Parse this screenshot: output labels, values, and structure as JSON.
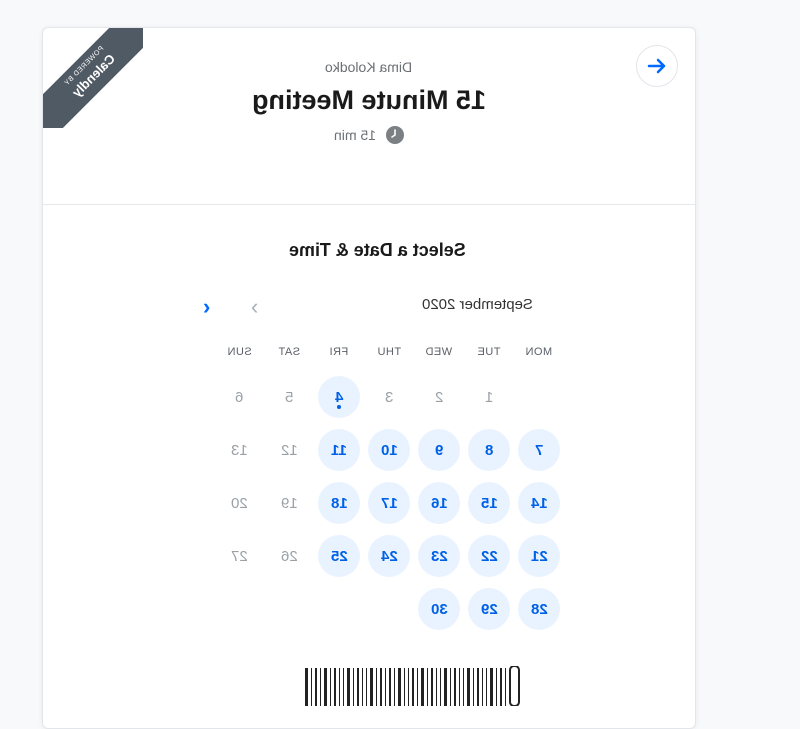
{
  "ribbon": {
    "small": "POWERED BY",
    "brand": "Calendly"
  },
  "header": {
    "owner": "Dima Kolodko",
    "title": "15 Minute Meeting",
    "duration": "15 min"
  },
  "calendar": {
    "section_title": "Select a Date & Time",
    "month": "September 2020",
    "weekdays": [
      "MON",
      "TUE",
      "WED",
      "THU",
      "FRI",
      "SAT",
      "SUN"
    ],
    "weeks": [
      [
        null,
        "1",
        "2",
        "3",
        "4",
        "5",
        "6"
      ],
      [
        "7",
        "8",
        "9",
        "10",
        "11",
        "12",
        "13"
      ],
      [
        "14",
        "15",
        "16",
        "17",
        "18",
        "19",
        "20"
      ],
      [
        "21",
        "22",
        "23",
        "24",
        "25",
        "26",
        "27"
      ],
      [
        "28",
        "29",
        "30",
        null,
        null,
        null,
        null
      ]
    ],
    "available": [
      "7",
      "8",
      "9",
      "10",
      "11",
      "14",
      "15",
      "16",
      "17",
      "18",
      "21",
      "22",
      "23",
      "24",
      "25",
      "28",
      "29",
      "30"
    ],
    "today": "4"
  },
  "colors": {
    "accent": "#0069ff",
    "available_bg": "#e9f3ff",
    "ribbon": "#505a64"
  },
  "icons": {
    "next_arrow": "arrow-right-icon",
    "clock": "clock-icon"
  }
}
